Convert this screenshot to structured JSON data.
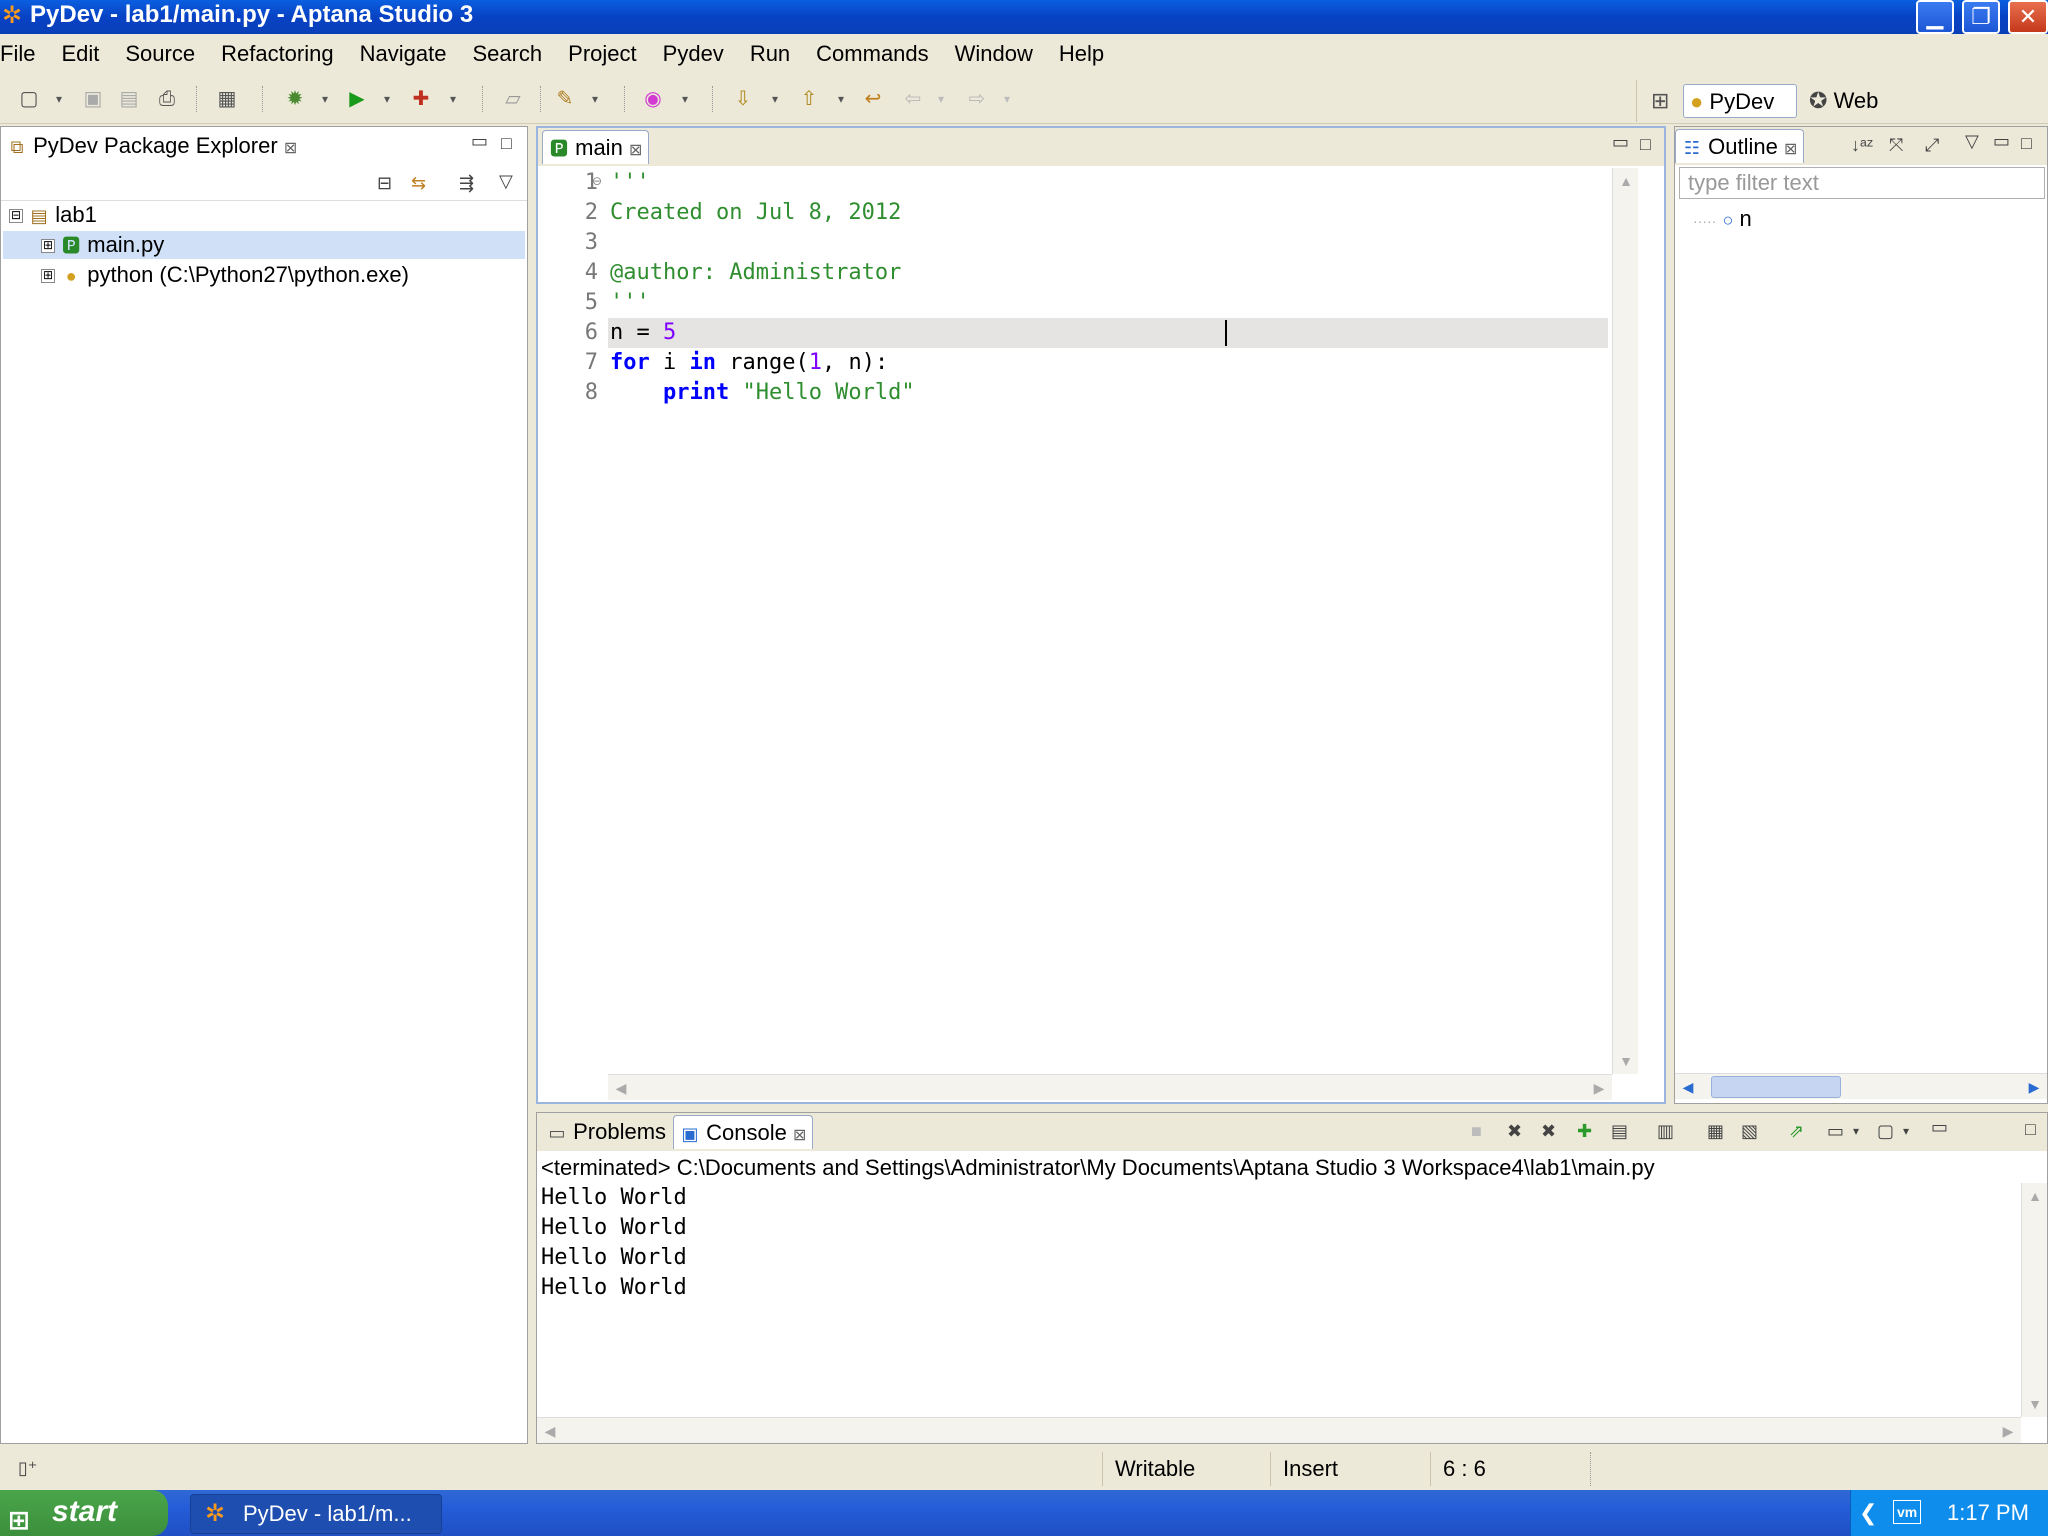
{
  "window": {
    "title": "PyDev - lab1/main.py - Aptana Studio 3"
  },
  "menu": [
    "File",
    "Edit",
    "Source",
    "Refactoring",
    "Navigate",
    "Search",
    "Project",
    "Pydev",
    "Run",
    "Commands",
    "Window",
    "Help"
  ],
  "perspectives": {
    "pydev": "PyDev",
    "web": "Web"
  },
  "explorer": {
    "title": "PyDev Package Explorer",
    "tree": [
      {
        "label": "lab1",
        "expand": "⊟"
      },
      {
        "label": "main.py",
        "expand": "⊞"
      },
      {
        "label": "python  (C:\\Python27\\python.exe)",
        "expand": "⊞"
      }
    ]
  },
  "editor": {
    "tab": "main",
    "lines": [
      {
        "n": "1",
        "parts": [
          {
            "t": "'''",
            "c": "c-doc"
          }
        ]
      },
      {
        "n": "2",
        "parts": [
          {
            "t": "Created on Jul 8, 2012",
            "c": "c-doc"
          }
        ]
      },
      {
        "n": "3",
        "parts": []
      },
      {
        "n": "4",
        "parts": [
          {
            "t": "@author: Administrator",
            "c": "c-doc"
          }
        ]
      },
      {
        "n": "5",
        "parts": [
          {
            "t": "'''",
            "c": "c-doc"
          }
        ]
      },
      {
        "n": "6",
        "parts": [
          {
            "t": "n = ",
            "c": ""
          },
          {
            "t": "5",
            "c": "c-num"
          }
        ]
      },
      {
        "n": "7",
        "parts": [
          {
            "t": "for",
            "c": "c-kw"
          },
          {
            "t": " i ",
            "c": ""
          },
          {
            "t": "in",
            "c": "c-kw"
          },
          {
            "t": " range(",
            "c": ""
          },
          {
            "t": "1",
            "c": "c-num"
          },
          {
            "t": ", n):",
            "c": ""
          }
        ]
      },
      {
        "n": "8",
        "parts": [
          {
            "t": "    ",
            "c": ""
          },
          {
            "t": "print",
            "c": "c-kw"
          },
          {
            "t": " ",
            "c": ""
          },
          {
            "t": "\"Hello World\"",
            "c": "c-str"
          }
        ]
      }
    ]
  },
  "outline": {
    "title": "Outline",
    "filter_placeholder": "type filter text",
    "items": [
      "n"
    ]
  },
  "bottom": {
    "tabs": {
      "problems": "Problems",
      "console": "Console"
    },
    "path": "<terminated> C:\\Documents and Settings\\Administrator\\My Documents\\Aptana Studio 3 Workspace4\\lab1\\main.py",
    "output": [
      "Hello World",
      "Hello World",
      "Hello World",
      "Hello World"
    ]
  },
  "status": {
    "writable": "Writable",
    "insert": "Insert",
    "position": "6 : 6"
  },
  "taskbar": {
    "start": "start",
    "task": "PyDev - lab1/m...",
    "clock": "1:17 PM",
    "tray_label": "vm"
  }
}
